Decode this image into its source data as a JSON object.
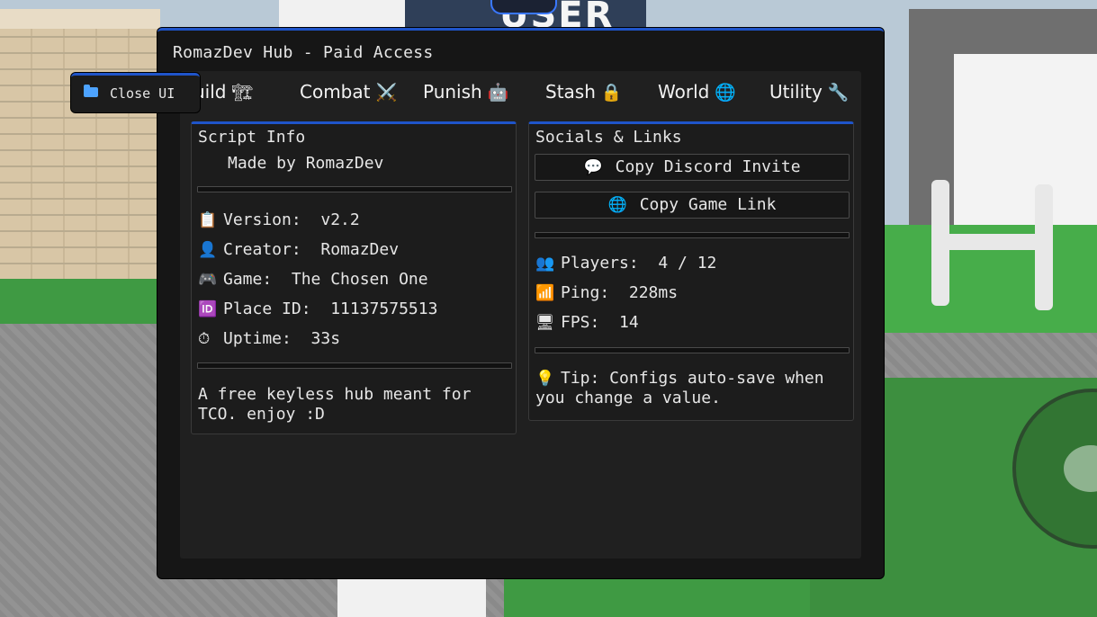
{
  "window": {
    "title": "RomazDev Hub - Paid Access",
    "accent": "#1f54c9"
  },
  "close_ui": {
    "label": "Close UI",
    "icon": "folder-icon"
  },
  "tabs": [
    {
      "label": "uild",
      "icon": "🏗"
    },
    {
      "label": "Combat",
      "icon": "⚔️"
    },
    {
      "label": "Punish",
      "icon": "🤖"
    },
    {
      "label": "Stash",
      "icon": "🔒"
    },
    {
      "label": "World",
      "icon": "🌐"
    },
    {
      "label": "Utility",
      "icon": "🔧"
    }
  ],
  "script_info": {
    "title": "Script Info",
    "made_by": "Made by RomazDev",
    "rows": [
      {
        "icon": "📋",
        "text": "Version:  v2.2"
      },
      {
        "icon": "👤",
        "text": "Creator:  RomazDev"
      },
      {
        "icon": "🎮",
        "text": "Game:  The Chosen One"
      },
      {
        "icon": "🆔",
        "text": "Place ID:  11137575513"
      },
      {
        "icon": "⏱",
        "text": "Uptime:  33s"
      }
    ],
    "description": "A free keyless hub meant for TCO. enjoy :D"
  },
  "socials": {
    "title": "Socials & Links",
    "buttons": [
      {
        "icon": "💬",
        "label": "Copy Discord Invite"
      },
      {
        "icon": "🌐",
        "label": "Copy Game Link"
      }
    ],
    "stats": [
      {
        "icon": "👥",
        "text": "Players:  4 / 12"
      },
      {
        "icon": "📶",
        "text": "Ping:  228ms"
      },
      {
        "icon": "🖥",
        "text": "FPS:  14"
      }
    ],
    "tip": {
      "icon": "💡",
      "text": "Tip: Configs auto-save when you change a value."
    }
  },
  "backdrop": {
    "banner_text": "USER"
  }
}
